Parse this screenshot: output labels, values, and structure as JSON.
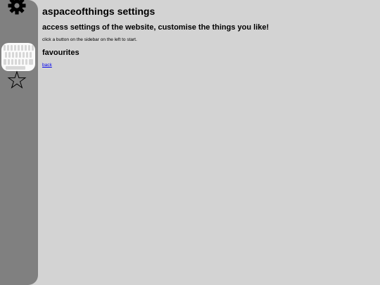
{
  "header": {
    "title": "aspaceofthings settings",
    "subtitle": "access settings of the website, customise the things you like!",
    "hint": "click a button on the sidebar on the left to start."
  },
  "sections": [
    {
      "title": "favourites",
      "link_label": "back"
    }
  ],
  "sidebar": {
    "items": [
      {
        "icon": "gear-icon"
      },
      {
        "icon": "keyboard-icon"
      },
      {
        "icon": "star-icon"
      }
    ]
  },
  "colors": {
    "background": "#d3d3d3",
    "sidebar": "#808080",
    "link": "#0000ee"
  }
}
